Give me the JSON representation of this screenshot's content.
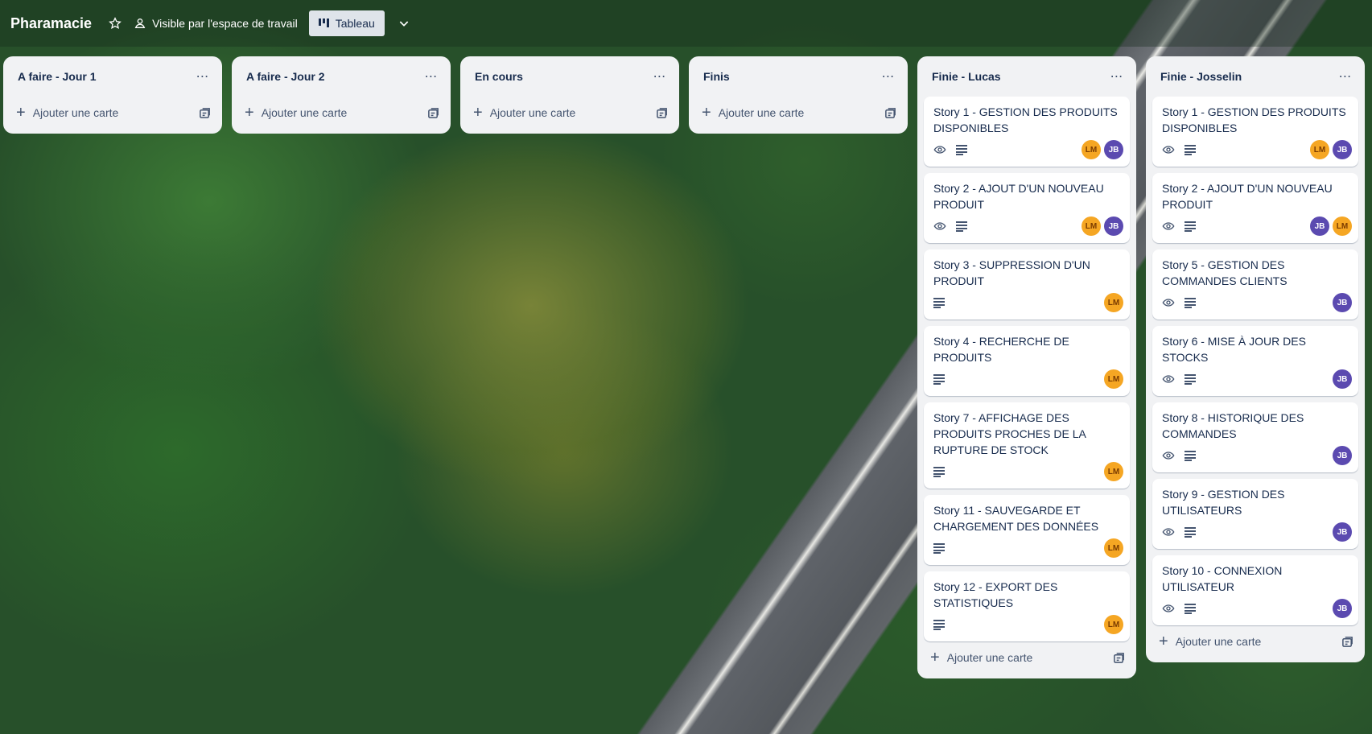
{
  "header": {
    "board_title": "Pharamacie",
    "visibility_label": "Visible par l'espace de travail",
    "view_label": "Tableau"
  },
  "add_card_label": "Ajouter une carte",
  "colors": {
    "avatar_lm": "#f5a623",
    "avatar_jb": "#5b4ab0",
    "list_bg": "#f1f2f4"
  },
  "lists": [
    {
      "title": "A faire - Jour 1",
      "cards": []
    },
    {
      "title": "A faire - Jour 2",
      "cards": []
    },
    {
      "title": "En cours",
      "cards": []
    },
    {
      "title": "Finis",
      "cards": []
    },
    {
      "title": "Finie - Lucas",
      "cards": [
        {
          "title": "Story 1 - GESTION DES PRODUITS DISPONIBLES",
          "watch": true,
          "desc": true,
          "members": [
            "LM",
            "JB"
          ]
        },
        {
          "title": "Story 2 - AJOUT D'UN NOUVEAU PRODUIT",
          "watch": true,
          "desc": true,
          "members": [
            "LM",
            "JB"
          ]
        },
        {
          "title": "Story 3 - SUPPRESSION D'UN PRODUIT",
          "watch": false,
          "desc": true,
          "members": [
            "LM"
          ]
        },
        {
          "title": "Story 4 - RECHERCHE DE PRODUITS",
          "watch": false,
          "desc": true,
          "members": [
            "LM"
          ]
        },
        {
          "title": "Story 7 - AFFICHAGE DES PRODUITS PROCHES DE LA RUPTURE DE STOCK",
          "watch": false,
          "desc": true,
          "members": [
            "LM"
          ]
        },
        {
          "title": "Story 11 - SAUVEGARDE ET CHARGEMENT DES DONNÉES",
          "watch": false,
          "desc": true,
          "members": [
            "LM"
          ]
        },
        {
          "title": "Story 12 - EXPORT DES STATISTIQUES",
          "watch": false,
          "desc": true,
          "members": [
            "LM"
          ]
        }
      ]
    },
    {
      "title": "Finie - Josselin",
      "cards": [
        {
          "title": "Story 1 - GESTION DES PRODUITS DISPONIBLES",
          "watch": true,
          "desc": true,
          "members": [
            "LM",
            "JB"
          ]
        },
        {
          "title": "Story 2 - AJOUT D'UN NOUVEAU PRODUIT",
          "watch": true,
          "desc": true,
          "members": [
            "JB",
            "LM"
          ]
        },
        {
          "title": "Story 5 - GESTION DES COMMANDES CLIENTS",
          "watch": true,
          "desc": true,
          "members": [
            "JB"
          ]
        },
        {
          "title": "Story 6 - MISE À JOUR DES STOCKS",
          "watch": true,
          "desc": true,
          "members": [
            "JB"
          ]
        },
        {
          "title": "Story 8 - HISTORIQUE DES COMMANDES",
          "watch": true,
          "desc": true,
          "members": [
            "JB"
          ]
        },
        {
          "title": "Story 9 - GESTION DES UTILISATEURS",
          "watch": true,
          "desc": true,
          "members": [
            "JB"
          ]
        },
        {
          "title": "Story 10 - CONNEXION UTILISATEUR",
          "watch": true,
          "desc": true,
          "members": [
            "JB"
          ]
        }
      ]
    }
  ]
}
